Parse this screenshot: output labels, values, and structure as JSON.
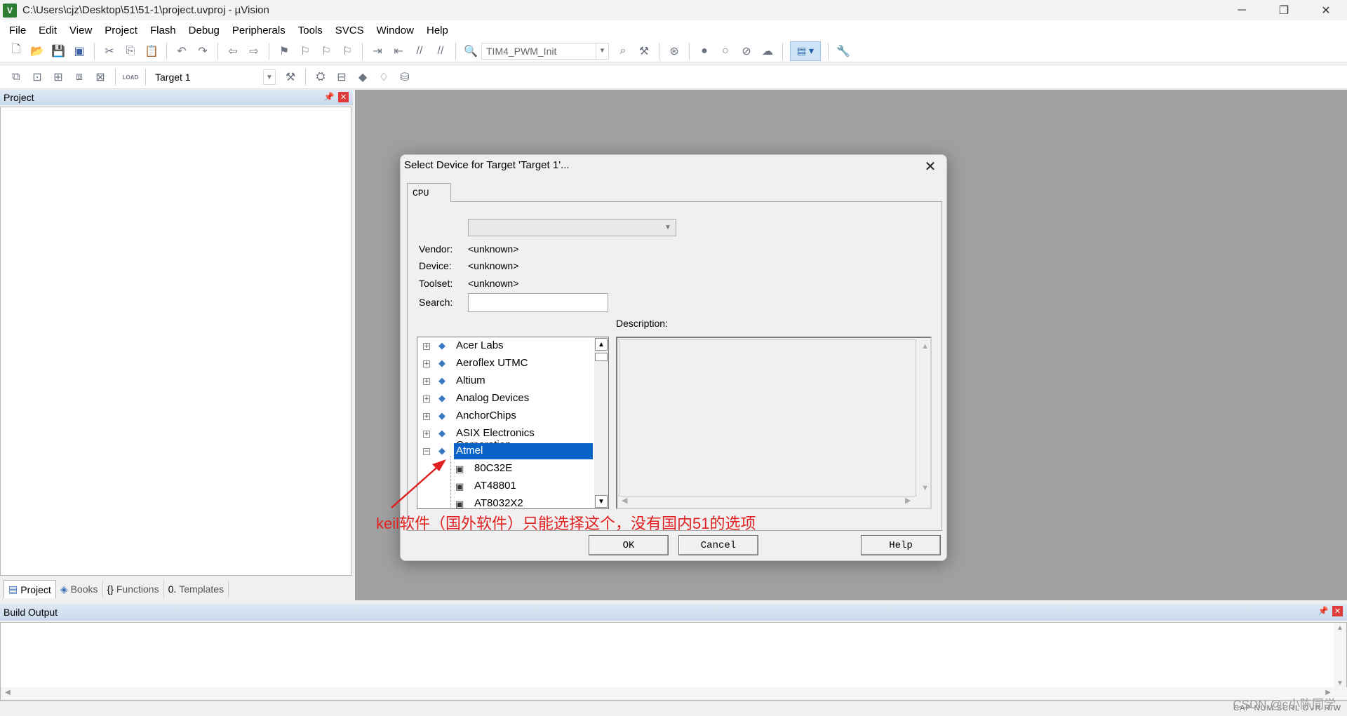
{
  "window": {
    "title": "C:\\Users\\cjz\\Desktop\\51\\51-1\\project.uvproj - µVision",
    "app_icon": "V",
    "controls": [
      "─",
      "❐",
      "✕"
    ]
  },
  "menu": [
    "File",
    "Edit",
    "View",
    "Project",
    "Flash",
    "Debug",
    "Peripherals",
    "Tools",
    "SVCS",
    "Window",
    "Help"
  ],
  "toolbar1": {
    "find_combo_value": "TIM4_PWM_Init"
  },
  "toolbar2": {
    "target_combo_value": "Target 1",
    "load_label": "LOAD"
  },
  "project_panel": {
    "title": "Project",
    "tabs": [
      "Project",
      "Books",
      "Functions",
      "Templates"
    ],
    "tab_icons": [
      "▤",
      "◈",
      "{}",
      "0."
    ]
  },
  "build_output": {
    "title": "Build Output"
  },
  "statusbar": {
    "indicators": "CAP NUM SCRL OVR R/W"
  },
  "watermark": "CSDN @c小陈同学",
  "dialog": {
    "title": "Select Device for Target 'Target 1'...",
    "tab": "CPU",
    "vendor_label": "Vendor:",
    "vendor_value": "<unknown>",
    "device_label": "Device:",
    "device_value": "<unknown>",
    "toolset_label": "Toolset:",
    "toolset_value": "<unknown>",
    "search_label": "Search:",
    "search_value": "",
    "description_label": "Description:",
    "vendors": [
      "Acer Labs",
      "Aeroflex UTMC",
      "Altium",
      "Analog Devices",
      "AnchorChips",
      "ASIX Electronics Corporation",
      "Atmel"
    ],
    "selected_vendor": "Atmel",
    "atmel_devices": [
      "80C32E",
      "AT48801",
      "AT8032X2"
    ],
    "buttons": {
      "ok": "OK",
      "cancel": "Cancel",
      "help": "Help"
    }
  },
  "annotation": {
    "text": "keil软件（国外软件）只能选择这个，没有国内51的选项",
    "color": "#e02020"
  },
  "colors": {
    "selection": "#0a64c8",
    "workspace": "#a0a0a0",
    "vendor_icon": "#3a78c2"
  }
}
